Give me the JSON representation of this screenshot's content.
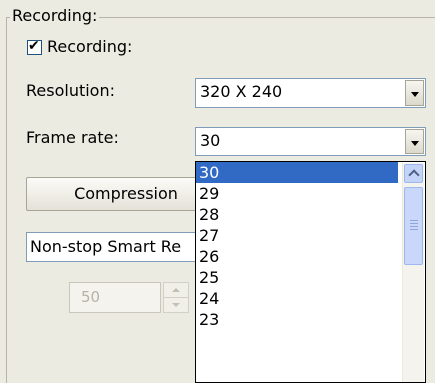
{
  "group": {
    "title": "Recording:"
  },
  "recording_checkbox": {
    "label": "Recording:",
    "checked": true,
    "check_glyph": "✔"
  },
  "resolution": {
    "label": "Resolution:",
    "value": "320 X 240"
  },
  "frame_rate": {
    "label": "Frame rate:",
    "value": "30",
    "options": [
      "30",
      "29",
      "28",
      "27",
      "26",
      "25",
      "24",
      "23"
    ],
    "selected_index": 0
  },
  "compression_button": {
    "label": "Compression"
  },
  "mode_select": {
    "value": "Non-stop Smart Re"
  },
  "spinner": {
    "value": "50"
  },
  "icons": {
    "dropdown_arrow": "chevron-down-icon",
    "scroll_up": "chevron-up-icon"
  },
  "colors": {
    "selection": "#316ac5",
    "background": "#ecebe1"
  }
}
